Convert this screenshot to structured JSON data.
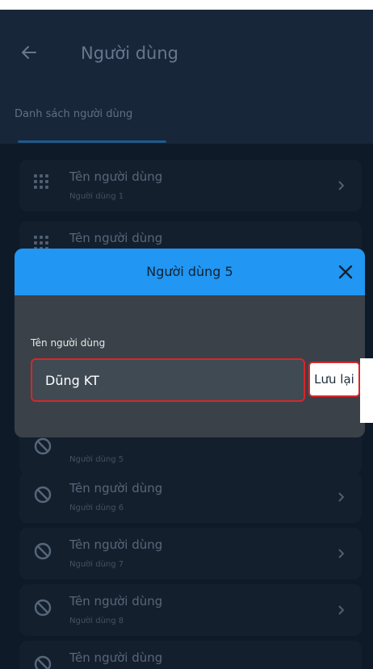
{
  "header": {
    "title": "Người dùng",
    "back_icon": "arrow-left-icon"
  },
  "tabs": [
    {
      "label": "Danh sách người dùng",
      "active": true
    }
  ],
  "users": [
    {
      "name": "Tên người dùng",
      "sub": "Người dùng 1",
      "icon": "keypad-icon"
    },
    {
      "name": "Tên người dùng",
      "sub": "",
      "icon": "keypad-icon"
    },
    {
      "name": "",
      "sub": "Người dùng 5",
      "icon": "block-icon"
    },
    {
      "name": "Tên người dùng",
      "sub": "Người dùng 6",
      "icon": "block-icon"
    },
    {
      "name": "Tên người dùng",
      "sub": "Người dùng 7",
      "icon": "block-icon"
    },
    {
      "name": "Tên người dùng",
      "sub": "Người dùng 8",
      "icon": "block-icon"
    },
    {
      "name": "Tên người dùng",
      "sub": "",
      "icon": "block-icon"
    }
  ],
  "modal": {
    "title": "Người dùng 5",
    "field_label": "Tên người dùng",
    "field_value": "Dũng KT",
    "save_label": "Lưu lại",
    "close_icon": "close-icon"
  },
  "colors": {
    "accent": "#2196f3",
    "highlight": "#d7262a",
    "background": "#0f1a28"
  }
}
